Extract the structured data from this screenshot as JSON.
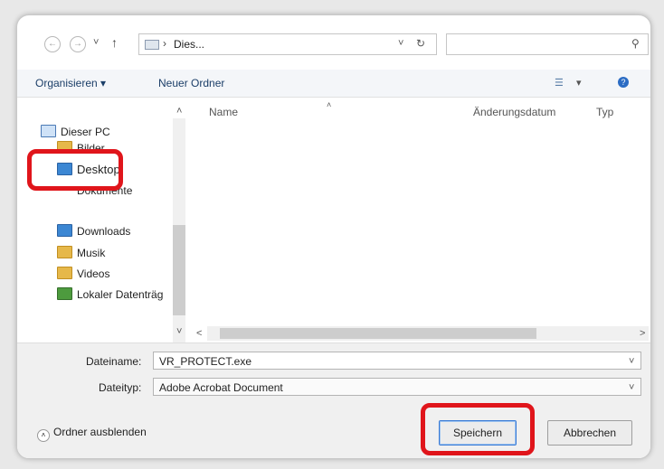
{
  "address": {
    "path": "Dies...",
    "arrows": "›"
  },
  "toolbar": {
    "organize": "Organisieren ▾",
    "new_folder": "Neuer Ordner"
  },
  "nav": {
    "items": [
      {
        "label": "Dieser PC"
      },
      {
        "label": "Bilder"
      },
      {
        "label": "Desktop"
      },
      {
        "label": "Dokumente"
      },
      {
        "label": "Downloads"
      },
      {
        "label": "Musik"
      },
      {
        "label": "Videos"
      },
      {
        "label": "Lokaler Datenträg"
      }
    ]
  },
  "columns": {
    "name": "Name",
    "date": "Änderungsdatum",
    "type": "Typ"
  },
  "filename": {
    "label": "Dateiname:",
    "value": "VR_PROTECT.exe"
  },
  "filetype": {
    "label": "Dateityp:",
    "value": "Adobe Acrobat Document"
  },
  "footer": {
    "hide_folders": "Ordner ausblenden",
    "save": "Speichern",
    "cancel": "Abbrechen"
  },
  "colors": {
    "highlight": "#e0151b",
    "accent": "#3a7bd5"
  }
}
